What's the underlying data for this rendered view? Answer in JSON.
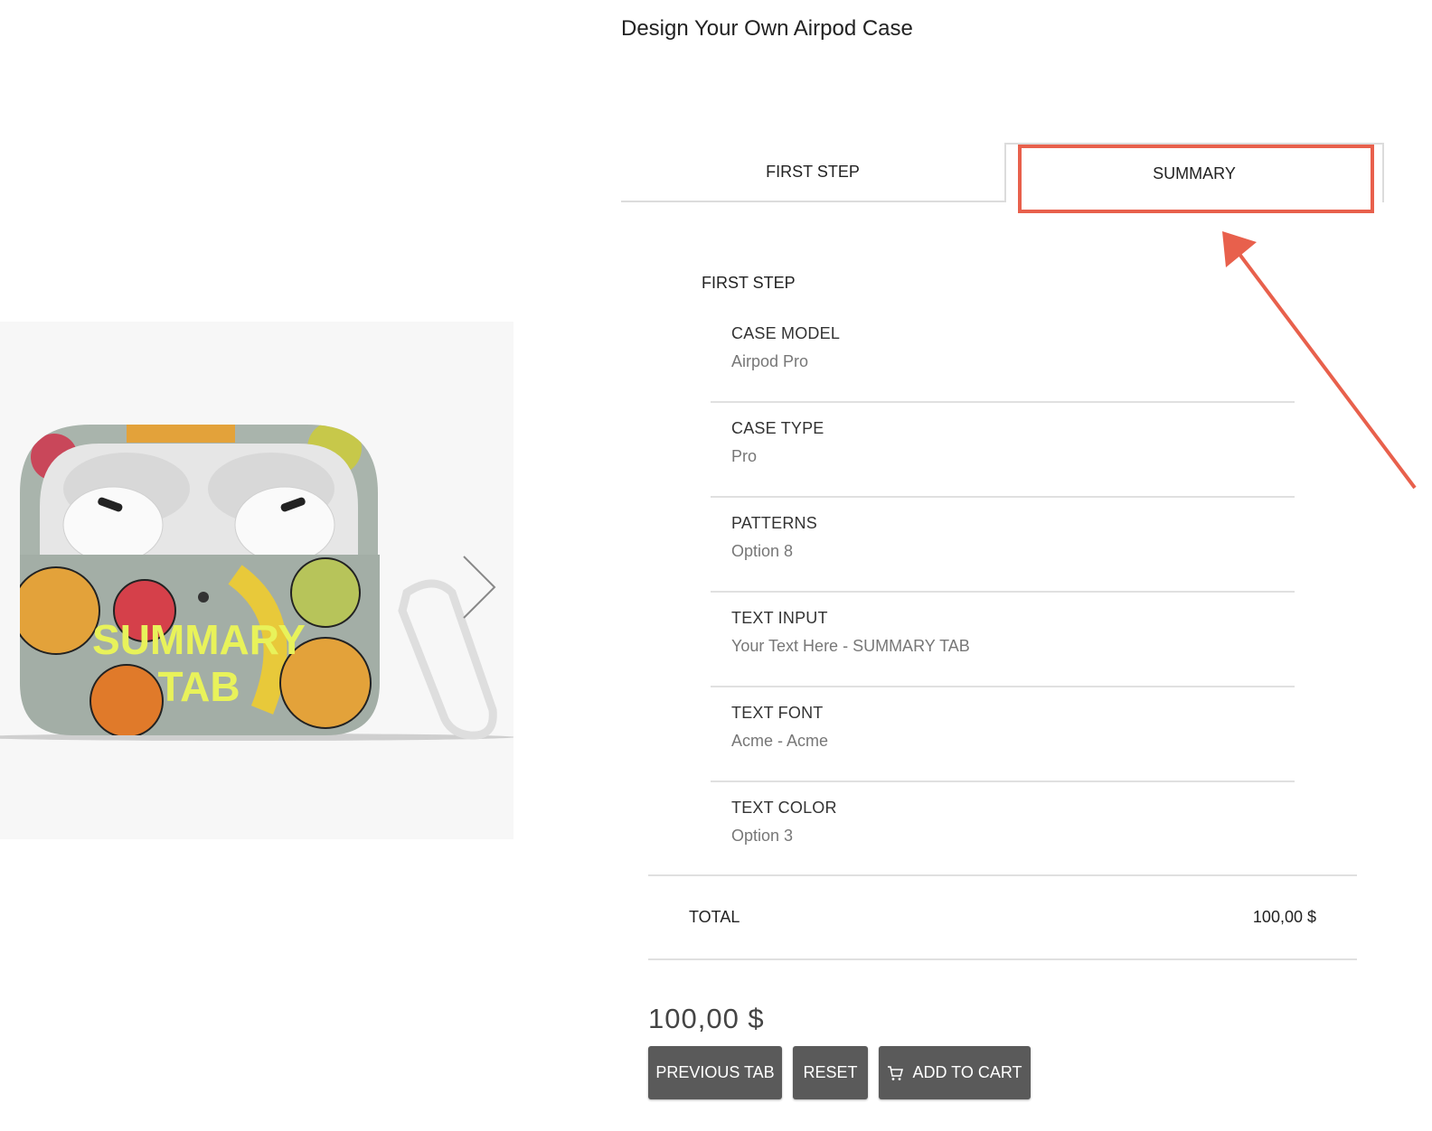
{
  "page": {
    "title": "Design Your Own Airpod Case"
  },
  "product_image": {
    "overlay_text_line1": "SUMMARY",
    "overlay_text_line2": "TAB",
    "overlay_text_color": "#e8f25a"
  },
  "tabs": [
    {
      "label": "FIRST STEP",
      "active": false
    },
    {
      "label": "SUMMARY",
      "active": true
    }
  ],
  "annotation": {
    "color": "#e8604c",
    "target": "tab-summary"
  },
  "summary": {
    "step_heading": "FIRST STEP",
    "rows": [
      {
        "label": "CASE MODEL",
        "value": "Airpod Pro"
      },
      {
        "label": "CASE TYPE",
        "value": "Pro"
      },
      {
        "label": "PATTERNS",
        "value": "Option 8"
      },
      {
        "label": "TEXT INPUT",
        "value": "Your Text Here - SUMMARY TAB"
      },
      {
        "label": "TEXT FONT",
        "value": "Acme - Acme"
      },
      {
        "label": "TEXT COLOR",
        "value": "Option 3"
      }
    ],
    "total_label": "TOTAL",
    "total_value": "100,00 $"
  },
  "price": "100,00 $",
  "buttons": {
    "previous_tab": "PREVIOUS TAB",
    "reset": "RESET",
    "add_to_cart": "ADD TO CART"
  },
  "colors": {
    "button_bg": "#5a5a5a",
    "annotation": "#e8604c"
  }
}
